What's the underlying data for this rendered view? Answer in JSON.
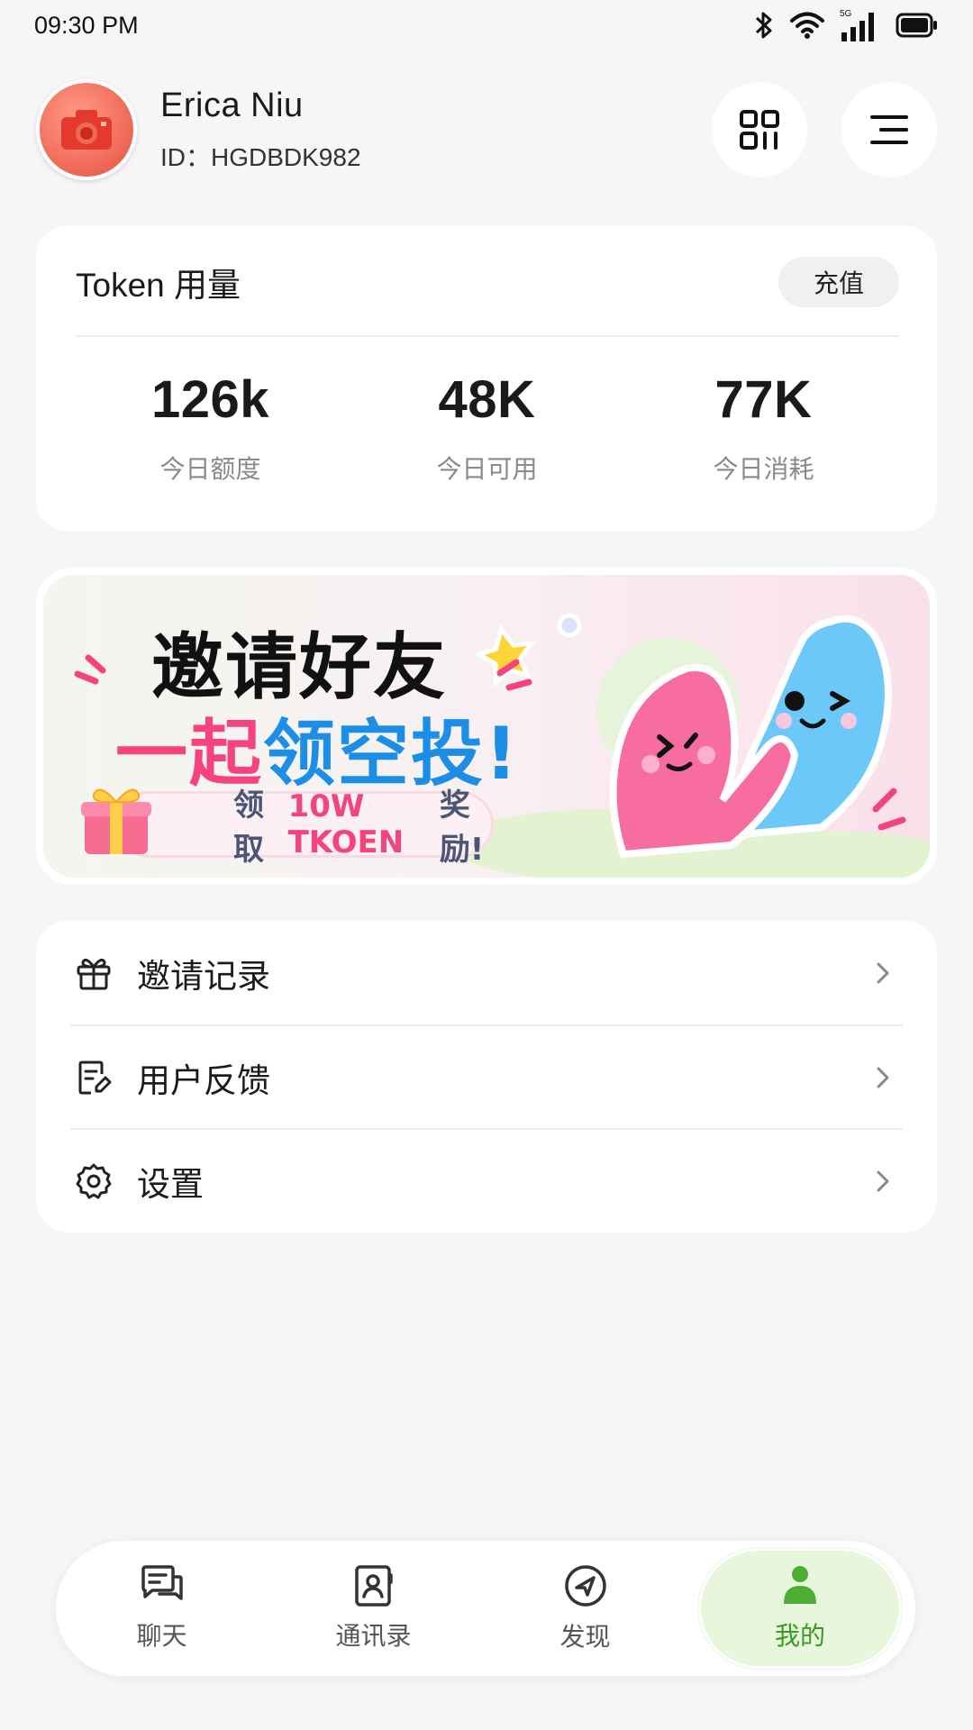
{
  "status_bar": {
    "time": "09:30 PM",
    "icons": [
      "bluetooth-icon",
      "wifi-icon",
      "5g-signal-icon",
      "battery-icon"
    ],
    "network_label": "5G"
  },
  "profile": {
    "name": "Erica Niu",
    "id_text": "ID：HGDBDK982",
    "avatar_icon": "camera-icon",
    "actions": [
      "qr-code-icon",
      "menu-icon"
    ]
  },
  "token_card": {
    "title": "Token 用量",
    "recharge_label": "充值",
    "stats": [
      {
        "value": "126k",
        "label": "今日额度"
      },
      {
        "value": "48K",
        "label": "今日可用"
      },
      {
        "value": "77K",
        "label": "今日消耗"
      }
    ]
  },
  "banner": {
    "line1": "邀请好友",
    "line2_part1": "一起",
    "line2_part2": "领空投",
    "line2_part3": "!",
    "reward_prefix": "领取",
    "reward_amount": "10W TKOEN",
    "reward_suffix": "奖励!",
    "colors": {
      "pink": "#f4437e",
      "blue": "#1d8ee6"
    }
  },
  "menu": {
    "items": [
      {
        "label": "邀请记录",
        "icon": "gift-icon"
      },
      {
        "label": "用户反馈",
        "icon": "feedback-icon"
      },
      {
        "label": "设置",
        "icon": "gear-icon"
      }
    ]
  },
  "bottom_nav": {
    "items": [
      {
        "label": "聊天",
        "icon": "chat-icon",
        "active": false
      },
      {
        "label": "通讯录",
        "icon": "contacts-icon",
        "active": false
      },
      {
        "label": "发现",
        "icon": "compass-icon",
        "active": false
      },
      {
        "label": "我的",
        "icon": "user-icon",
        "active": true
      }
    ],
    "active_color": "#3a9a25"
  }
}
